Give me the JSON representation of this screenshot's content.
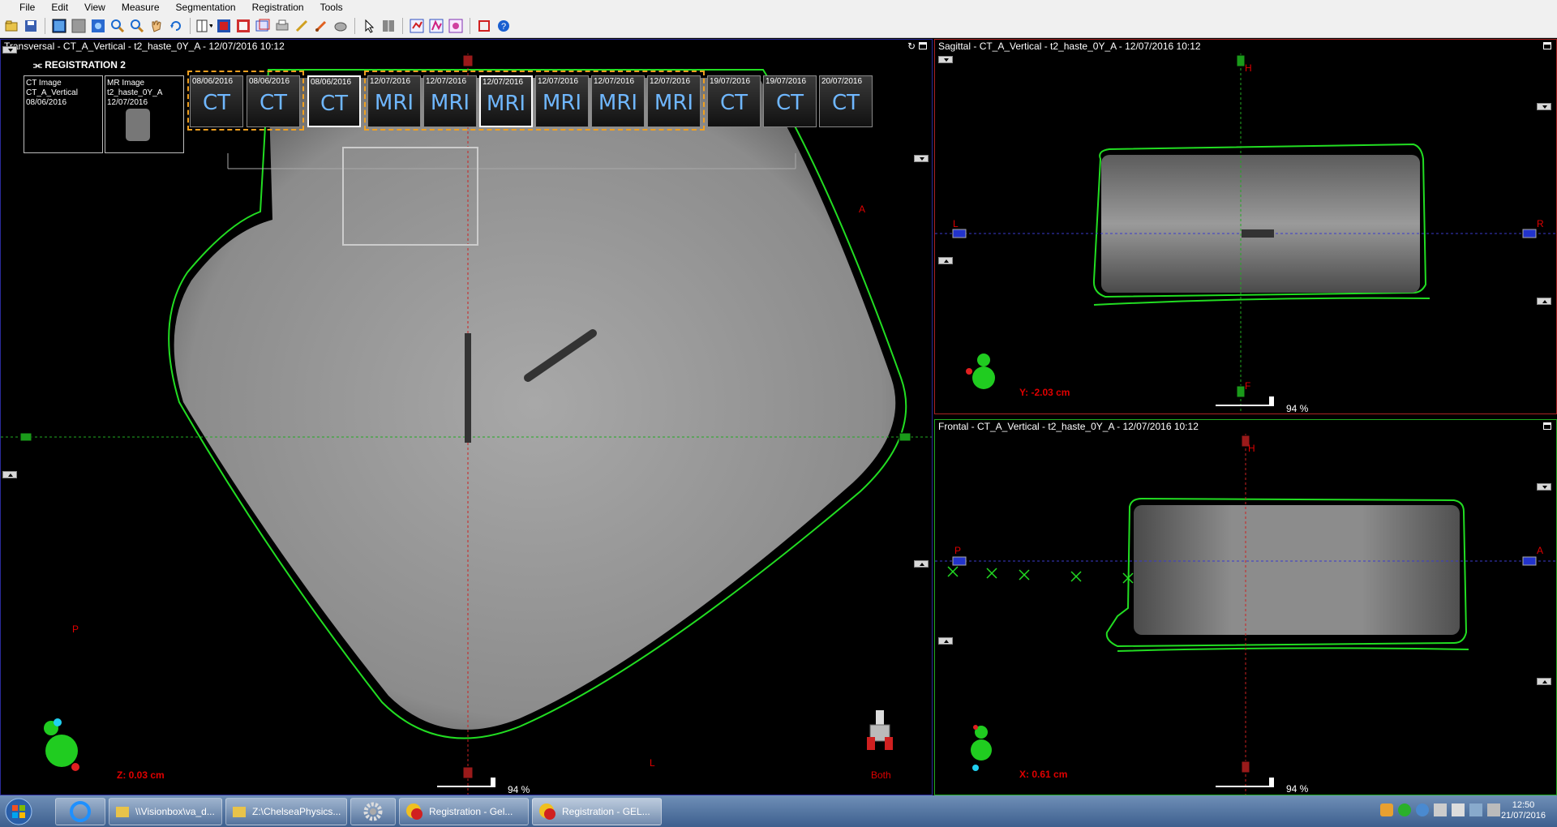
{
  "menu": [
    "File",
    "Edit",
    "View",
    "Measure",
    "Segmentation",
    "Registration",
    "Tools"
  ],
  "toolbar_icons": [
    "open-icon",
    "save-icon",
    "view-1-icon",
    "view-2-icon",
    "view-3-icon",
    "zoom-in-icon",
    "zoom-out-icon",
    "pan-hand-icon",
    "rotate-icon",
    "layout-icon",
    "window-level-icon",
    "fusion-icon",
    "screenshot-icon",
    "print-icon",
    "pencil-icon",
    "brush-icon",
    "eraser-icon",
    "pointer-icon",
    "ruler-icon",
    "grid-icon",
    "point-icon",
    "deformation-icon",
    "crop-icon",
    "info-icon"
  ],
  "transversal": {
    "title": "Transversal - CT_A_Vertical - t2_haste_0Y_A - 12/07/2016 10:12",
    "registration_label": "REGISTRATION 2",
    "thumbs": [
      {
        "l1": "CT Image",
        "l2": "CT_A_Vertical",
        "l3": "08/06/2016"
      },
      {
        "l1": "MR Image",
        "l2": "t2_haste_0Y_A",
        "l3": "12/07/2016"
      }
    ],
    "tiles": [
      {
        "date": "08/06/2016",
        "mod": "CT"
      },
      {
        "date": "08/06/2016",
        "mod": "CT"
      },
      {
        "date": "08/06/2016",
        "mod": "CT"
      },
      {
        "date": "12/07/2016",
        "mod": "MRI"
      },
      {
        "date": "12/07/2016",
        "mod": "MRI"
      },
      {
        "date": "12/07/2016",
        "mod": "MRI"
      },
      {
        "date": "12/07/2016",
        "mod": "MRI"
      },
      {
        "date": "12/07/2016",
        "mod": "MRI"
      },
      {
        "date": "12/07/2016",
        "mod": "MRI"
      },
      {
        "date": "19/07/2016",
        "mod": "CT"
      },
      {
        "date": "19/07/2016",
        "mod": "CT"
      },
      {
        "date": "20/07/2016",
        "mod": "CT"
      }
    ],
    "orient": {
      "a": "A",
      "p": "P",
      "l": "L"
    },
    "coord": "Z: 0.03 cm",
    "zoom": "94 %",
    "both": "Both"
  },
  "sagittal": {
    "title": "Sagittal - CT_A_Vertical - t2_haste_0Y_A - 12/07/2016 10:12",
    "orient": {
      "h": "H",
      "f": "F",
      "l": "L",
      "r": "R"
    },
    "coord": "Y: -2.03 cm",
    "zoom": "94 %"
  },
  "frontal": {
    "title": "Frontal - CT_A_Vertical - t2_haste_0Y_A - 12/07/2016 10:12",
    "orient": {
      "h": "H",
      "p": "P",
      "a": "A"
    },
    "coord": "X: 0.61 cm",
    "zoom": "94 %"
  },
  "taskbar": {
    "items": [
      "\\\\Visionbox\\va_d...",
      "Z:\\ChelseaPhysics...",
      "",
      "Registration - Gel...",
      "Registration - GEL..."
    ],
    "time": "12:50",
    "date": "21/07/2016"
  },
  "colors": {
    "contour": "#22dd22",
    "crosshair_h": "#3a3acc",
    "crosshair_v": "#22aa22",
    "accent_orange": "#f0a020",
    "red": "#e00000"
  }
}
